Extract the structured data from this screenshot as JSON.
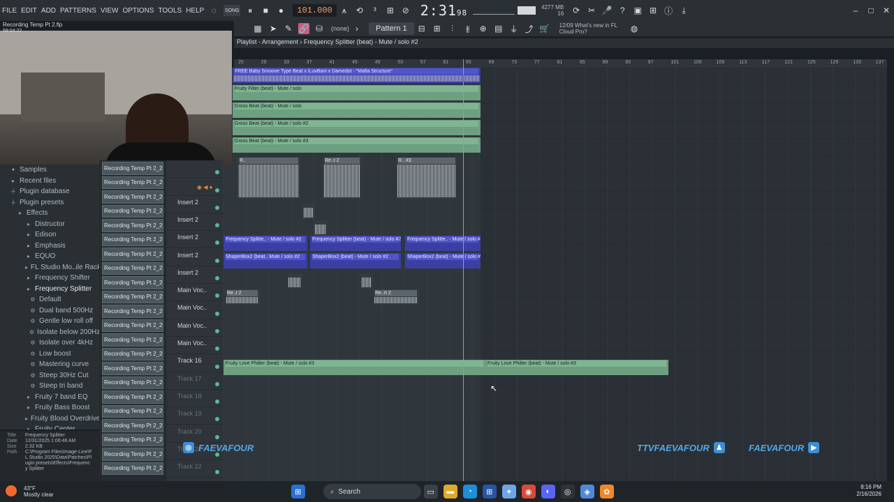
{
  "menu": [
    "FILE",
    "EDIT",
    "ADD",
    "PATTERNS",
    "VIEW",
    "OPTIONS",
    "TOOLS",
    "HELP"
  ],
  "transport": {
    "song_label": "SONG",
    "tempo": "101.000",
    "time": "2:31",
    "time_fraction": "98",
    "time_unit": "M:S:CS",
    "cpu_mb": "4277 MB",
    "cpu_poly": "16",
    "cpu_num": "9"
  },
  "toolbar2": {
    "none": "(none)",
    "pattern": "Pattern 1",
    "news_date": "12/09",
    "news_line1": "What's new in FL",
    "news_line2": "Cloud Pro?"
  },
  "project": {
    "name": "Recording Temp Pt 2.flp",
    "time": "59:04:22",
    "track": "Track 17"
  },
  "playlist_title": "Playlist - Arrangement  ›  Frequency Splitter (beat) - Mute / solo #2",
  "ruler": [
    "25",
    "29",
    "33",
    "37",
    "41",
    "45",
    "49",
    "53",
    "57",
    "61",
    "65",
    "69",
    "73",
    "77",
    "81",
    "85",
    "89",
    "93",
    "97",
    "101",
    "105",
    "109",
    "113",
    "117",
    "121",
    "125",
    "129",
    "133",
    "137"
  ],
  "browser": [
    {
      "label": "Samples",
      "icon": "star-icon"
    },
    {
      "label": "Recent files",
      "icon": "folder-icon"
    },
    {
      "label": "Plugin database",
      "icon": "plug-icon"
    },
    {
      "label": "Plugin presets",
      "icon": "plug-icon"
    },
    {
      "label": "Effects",
      "icon": "folder-icon"
    },
    {
      "label": "Distructor",
      "icon": "folder-icon"
    },
    {
      "label": "Edison",
      "icon": "folder-icon"
    },
    {
      "label": "Emphasis",
      "icon": "folder-icon"
    },
    {
      "label": "EQUO",
      "icon": "folder-icon"
    },
    {
      "label": "FL Studio Mo..ile Rack FX",
      "icon": "folder-icon"
    },
    {
      "label": "Frequency Shifter",
      "icon": "folder-icon"
    },
    {
      "label": "Frequency Splitter",
      "icon": "folder-icon"
    },
    {
      "label": "Default",
      "icon": "gear-icon"
    },
    {
      "label": "Dual band 500Hz",
      "icon": "gear-icon"
    },
    {
      "label": "Gentle low roll off",
      "icon": "gear-icon"
    },
    {
      "label": "Isolate below 200Hz",
      "icon": "gear-icon"
    },
    {
      "label": "Isolate over 4kHz",
      "icon": "gear-icon"
    },
    {
      "label": "Low boost",
      "icon": "gear-icon"
    },
    {
      "label": "Mastering curve",
      "icon": "gear-icon"
    },
    {
      "label": "Steep 30Hz Cut",
      "icon": "gear-icon"
    },
    {
      "label": "Steep tri band",
      "icon": "gear-icon"
    },
    {
      "label": "Fruity 7 band EQ",
      "icon": "folder-icon"
    },
    {
      "label": "Fruity Bass Boost",
      "icon": "folder-icon"
    },
    {
      "label": "Fruity Blood Overdrive",
      "icon": "folder-icon"
    },
    {
      "label": "Fruity Center",
      "icon": "folder-icon"
    }
  ],
  "info": {
    "title_k": "Title",
    "title_v": "Frequency Splitter",
    "date_k": "Date",
    "date_v": "12/31/2025 1:06:46 AM",
    "size_k": "Size",
    "size_v": "2.32 KB",
    "path_k": "Path",
    "path_v": "C:\\Program Files\\Image-Line\\FL Studio 2025\\Data\\Patches\\Plugin presets\\Effects\\Frequency Splitter"
  },
  "clip_name": "Recording Temp Pt 2_202...",
  "tracks": [
    {
      "label": "",
      "dim": false
    },
    {
      "label": "",
      "dim": false
    },
    {
      "label": "Insert 2",
      "dim": false
    },
    {
      "label": "Insert 2",
      "dim": false
    },
    {
      "label": "Insert 2",
      "dim": false
    },
    {
      "label": "Insert 2",
      "dim": false
    },
    {
      "label": "Insert 2",
      "dim": false
    },
    {
      "label": "Main Voc..",
      "dim": false
    },
    {
      "label": "Main Voc..",
      "dim": false
    },
    {
      "label": "Main Voc..",
      "dim": false
    },
    {
      "label": "Main Voc..",
      "dim": false
    },
    {
      "label": "Track 16",
      "dim": false
    },
    {
      "label": "Track 17",
      "dim": true
    },
    {
      "label": "Track 18",
      "dim": true
    },
    {
      "label": "Track 19",
      "dim": true
    },
    {
      "label": "Track 20",
      "dim": true
    },
    {
      "label": "Track 21",
      "dim": true
    },
    {
      "label": "Track 22",
      "dim": true
    }
  ],
  "clips_top": [
    {
      "label": "FREE Baby Smoove Type Beat x iLuvBani x Damedot - \"Mafia Structure\"",
      "kind": "blue"
    },
    {
      "label": "Fruity Filter (beat) - Mute / solo",
      "kind": "green"
    },
    {
      "label": "Gross Beat (beat) - Mute / solo",
      "kind": "green"
    },
    {
      "label": "Gross Beat (beat) - Mute / solo #2",
      "kind": "green"
    },
    {
      "label": "Gross Beat (beat) - Mute / solo #3",
      "kind": "green"
    }
  ],
  "clips_mid": [
    {
      "label": "Frequency Splitte.. - Mute / solo #2",
      "kind": "blue"
    },
    {
      "label": "Frequency Splitter (beat) - Mute / solo #2",
      "kind": "blue"
    },
    {
      "label": "Frequency Splitte.. - Mute / solo #2",
      "kind": "blue"
    },
    {
      "label": "ShaperBox2 (beat.. Mute / solo #2",
      "kind": "blue"
    },
    {
      "label": "ShaperBox2 (beat) - Mute / solo #2",
      "kind": "blue"
    },
    {
      "label": "ShaperBox2 (beat) - Mute / solo #2",
      "kind": "blue"
    },
    {
      "label": "Fruity Love Philter (beat) - Mute / solo #3",
      "kind": "green"
    },
    {
      "label": "Fruity Love Philter (beat) - Mute / solo #3",
      "kind": "green"
    }
  ],
  "audio_labels": {
    "a1": "R..",
    "a2": "Re..t 2",
    "a3": "R.. #3",
    "v1": "Re..t 2",
    "v2": "Re..rt 2"
  },
  "social": {
    "left": "FAEVAFOUR",
    "right1": "TTVFAEVAFOUR",
    "right2": "FAEVAFOUR"
  },
  "taskbar": {
    "temp": "43°F",
    "weather": "Mostly clear",
    "search": "Search",
    "time": "8:16 PM",
    "date": "2/16/2026"
  },
  "colors": {
    "accent_tempo": "#f5a25c",
    "clip_green": "#6d9f80",
    "clip_blue": "#3b3fa4",
    "social_blue": "#52a8e6"
  }
}
